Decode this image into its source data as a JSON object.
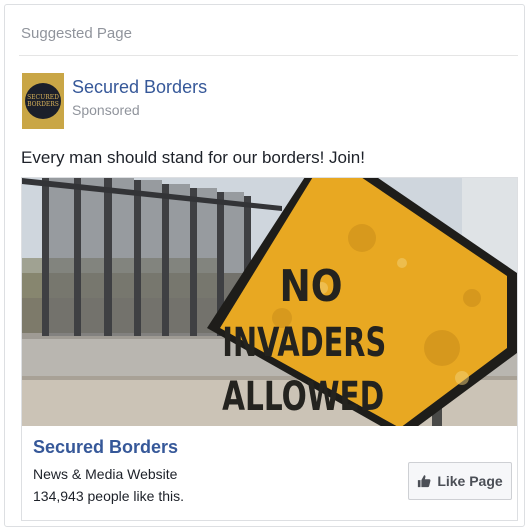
{
  "header": {
    "label": "Suggested Page"
  },
  "page": {
    "name": "Secured Borders",
    "sponsored": "Sponsored",
    "avatar_text": [
      "SECURED",
      "BORDERS"
    ]
  },
  "post": {
    "text": "Every man should stand for our borders! Join!"
  },
  "media": {
    "sign_lines": [
      "NO",
      "INVADERS",
      "ALLOWED"
    ]
  },
  "footer": {
    "title": "Secured Borders",
    "category": "News & Media Website",
    "likes": "134,943 people like this.",
    "like_button": "Like Page"
  },
  "colors": {
    "link": "#365899",
    "muted": "#90949c",
    "sign": "#e8a822"
  },
  "icons": [
    "thumbs-up-icon"
  ]
}
